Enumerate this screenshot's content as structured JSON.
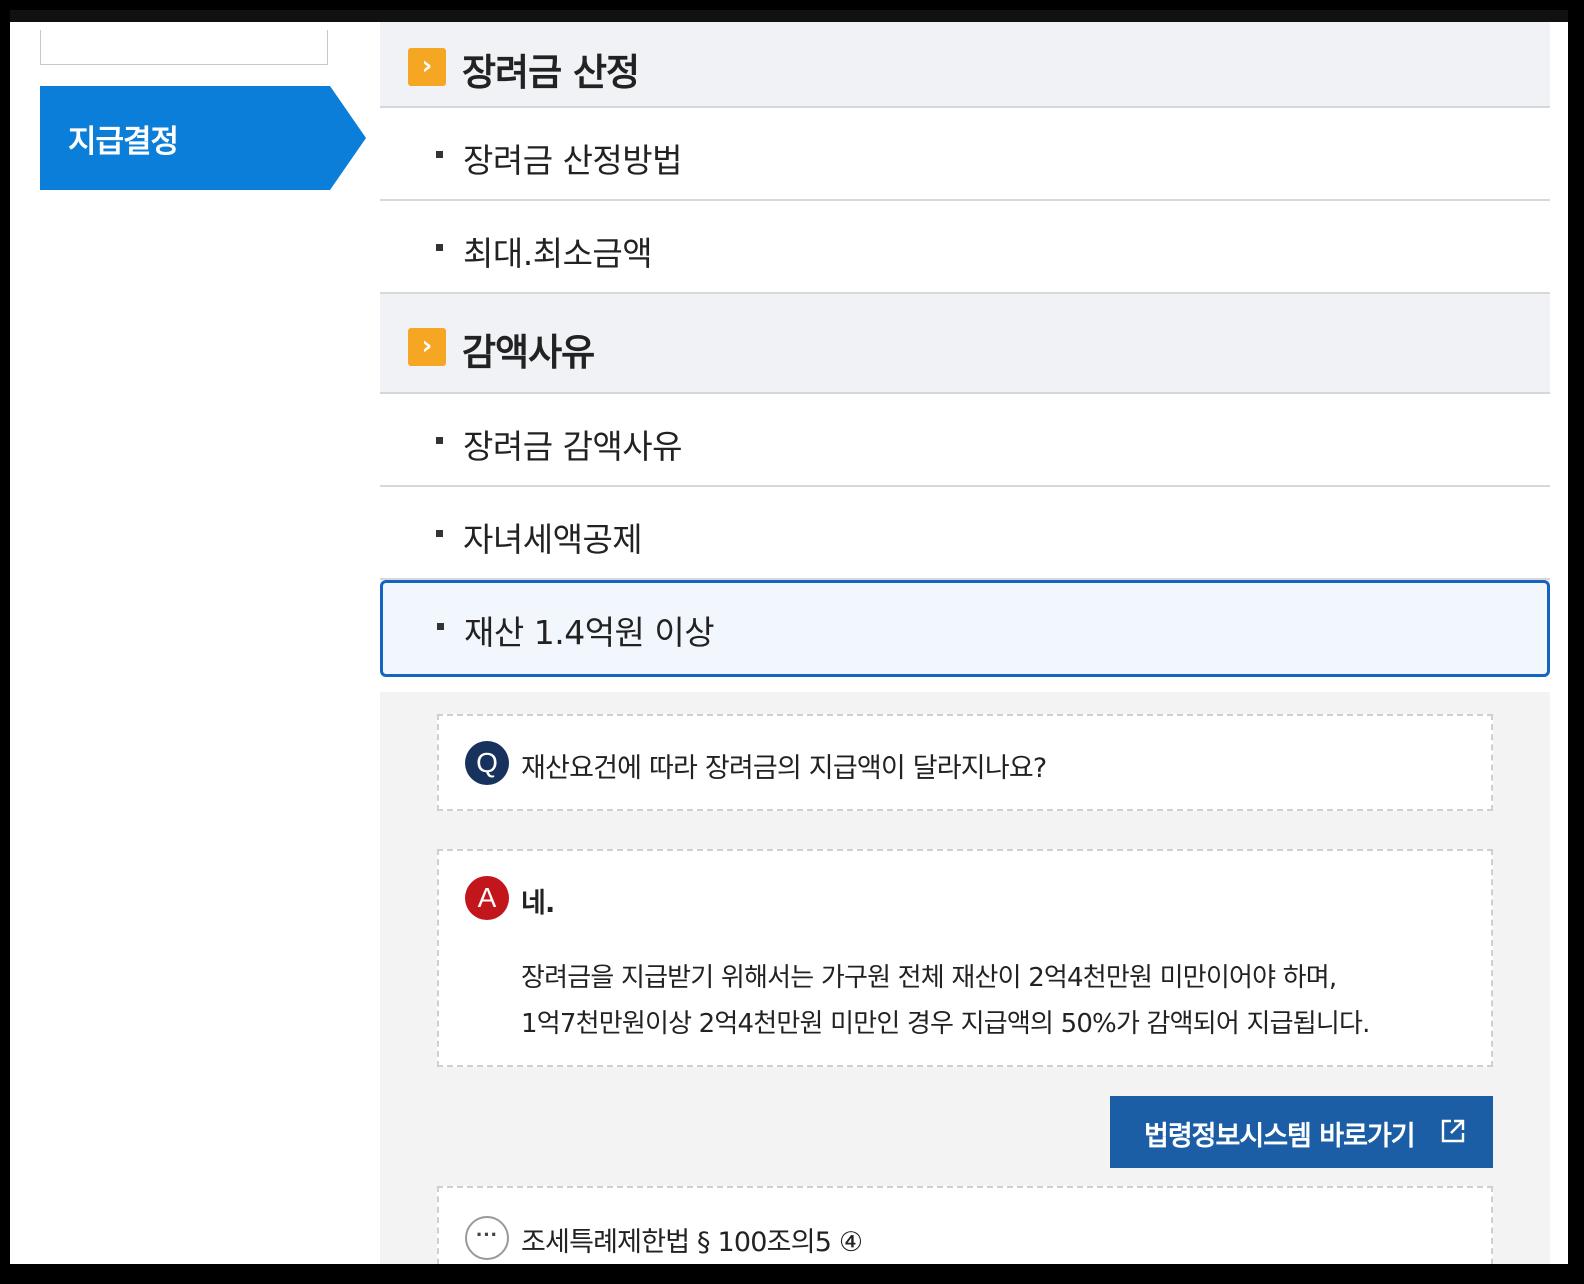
{
  "sidebar": {
    "active_label": "지급결정"
  },
  "sections": [
    {
      "title": "장려금 산정",
      "icon": "chevron-right-icon",
      "items": [
        "장려금 산정방법",
        "최대.최소금액"
      ]
    },
    {
      "title": "감액사유",
      "icon": "chevron-right-icon",
      "items": [
        "장려금 감액사유",
        "자녀세액공제",
        "재산 1.4억원 이상"
      ]
    }
  ],
  "selected_item": "재산 1.4억원 이상",
  "faq": {
    "q_badge": "Q",
    "question": "재산요건에 따라 장려금의 지급액이 달라지나요?",
    "a_badge": "A",
    "answer_title": "네.",
    "answer_line1": "장려금을 지급받기 위해서는 가구원 전체 재산이 2억4천만원 미만이어야 하며,",
    "answer_line2": "1억7천만원이상 2억4천만원 미만인 경우 지급액의 50%가 감액되어 지급됩니다.",
    "law_button": "법령정보시스템 바로가기",
    "law_ref_badge": "···",
    "law_ref": "조세특례제한법 § 100조의5 ④"
  },
  "colors": {
    "sidebar_active": "#0a7ed8",
    "section_icon": "#f5a623",
    "q_badge": "#17325c",
    "a_badge": "#c3161c",
    "button": "#1c5ea6",
    "selected_border": "#1565c0"
  }
}
